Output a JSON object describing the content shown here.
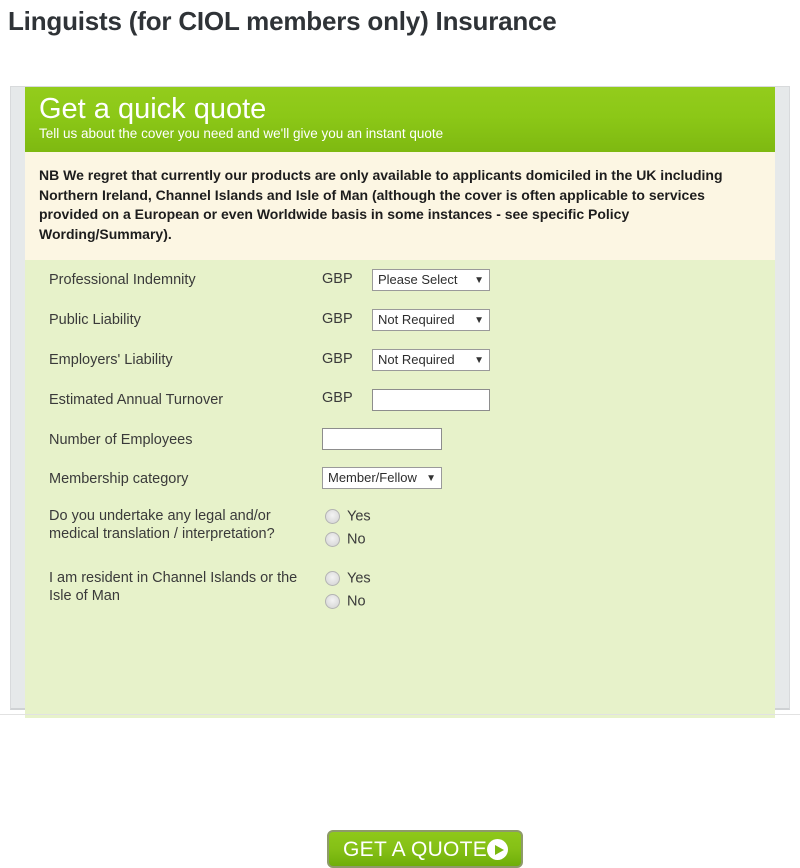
{
  "page": {
    "title": "Linguists (for CIOL members only) Insurance"
  },
  "quote_panel": {
    "header": {
      "title": "Get a quick quote",
      "subtitle": "Tell us about the cover you need and we'll give you an instant quote"
    },
    "notice": "NB We regret that currently our products are only available to applicants domiciled in the UK including Northern Ireland, Channel Islands and Isle of Man (although the cover is often applicable to services provided on a European or even Worldwide basis in some instances - see specific Policy Wording/Summary).",
    "currency_label": "GBP",
    "fields": [
      {
        "label": "Professional Indemnity",
        "currency": "GBP",
        "control": "select",
        "value": "Please Select"
      },
      {
        "label": "Public Liability",
        "currency": "GBP",
        "control": "select",
        "value": "Not Required"
      },
      {
        "label": "Employers' Liability",
        "currency": "GBP",
        "control": "select",
        "value": "Not Required"
      },
      {
        "label": "Estimated Annual Turnover",
        "currency": "GBP",
        "control": "text",
        "value": ""
      },
      {
        "label": "Number of Employees",
        "currency": "",
        "control": "text",
        "value": ""
      },
      {
        "label": "Membership category",
        "currency": "",
        "control": "select",
        "value": "Member/Fellow"
      }
    ],
    "radio_questions": [
      {
        "label_line1": "Do you undertake any legal and/or",
        "label_line2": "medical translation / interpretation?",
        "options": [
          {
            "label": "Yes",
            "selected": false
          },
          {
            "label": "No",
            "selected": false
          }
        ]
      },
      {
        "label_line1": "I am resident in Channel Islands or the",
        "label_line2": "Isle of Man",
        "options": [
          {
            "label": "Yes",
            "selected": false
          },
          {
            "label": "No",
            "selected": false
          }
        ]
      }
    ],
    "submit": {
      "label": "GET A QUOTE",
      "icon": "play-circle-icon"
    }
  },
  "colors": {
    "header_green": "#8cc817",
    "body_green": "#e7f2ca",
    "notice_cream": "#fcf6e3",
    "button_green": "#85c016",
    "card_gray": "#e6e9ea"
  }
}
